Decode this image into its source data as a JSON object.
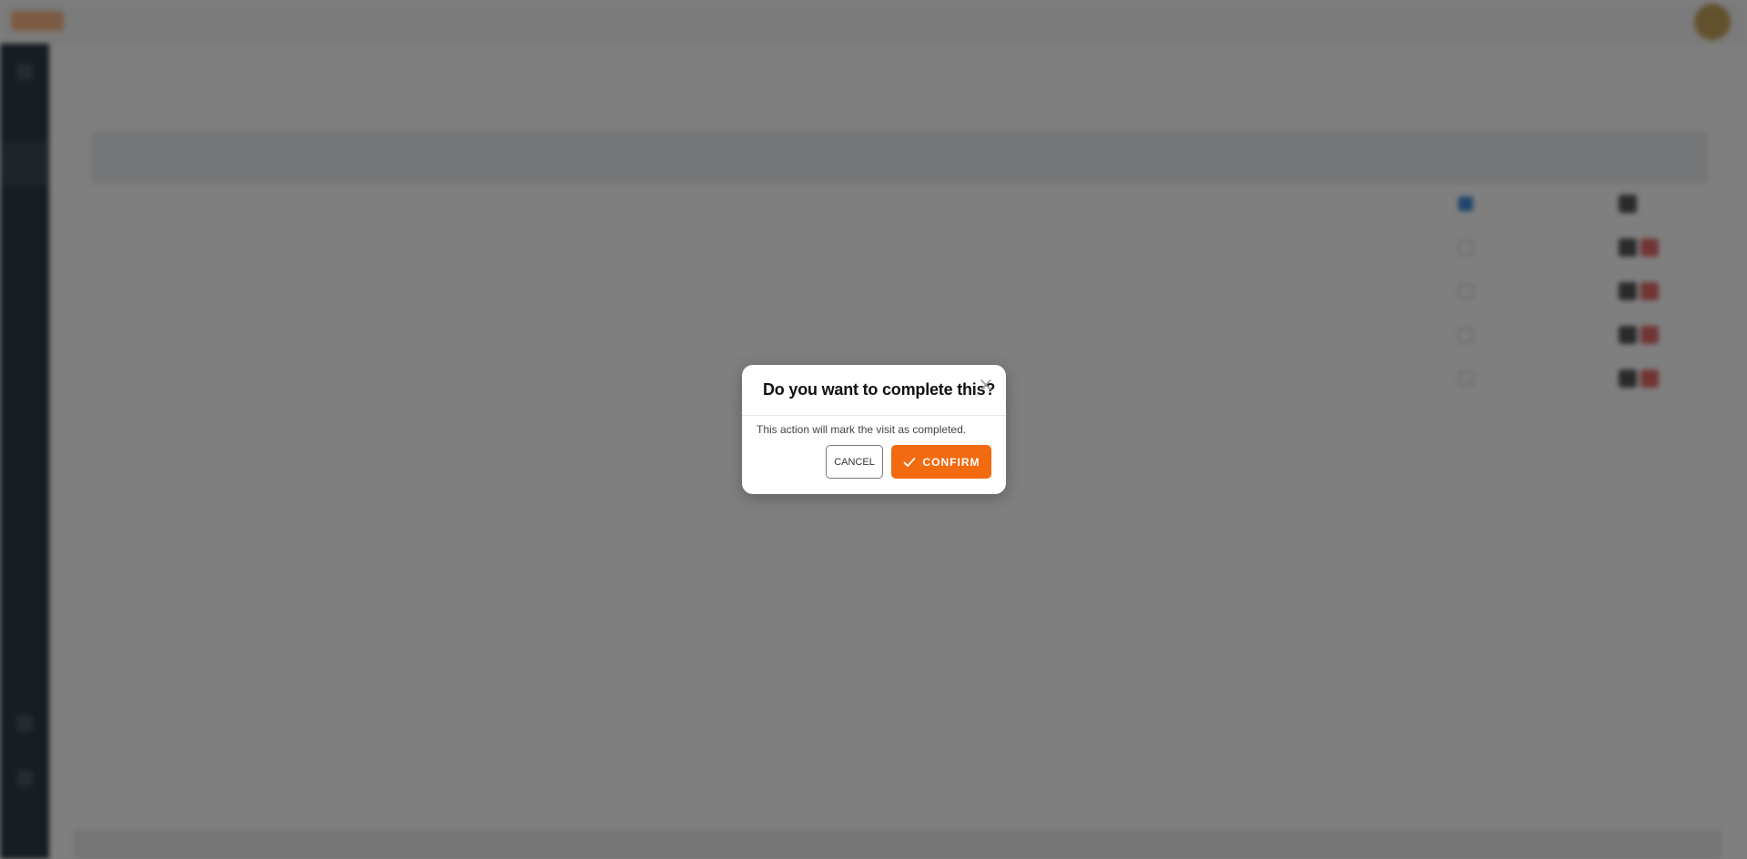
{
  "modal": {
    "title": "Do you want to complete this?",
    "message": "This action will mark the visit as completed.",
    "cancel_label": "CANCEL",
    "confirm_label": "CONFIRM"
  },
  "colors": {
    "accent": "#f26b10",
    "overlay": "rgba(0,0,0,0.5)",
    "sidebar": "#2f3a46"
  },
  "icons": {
    "close": "close-icon",
    "confirm": "check-icon"
  }
}
